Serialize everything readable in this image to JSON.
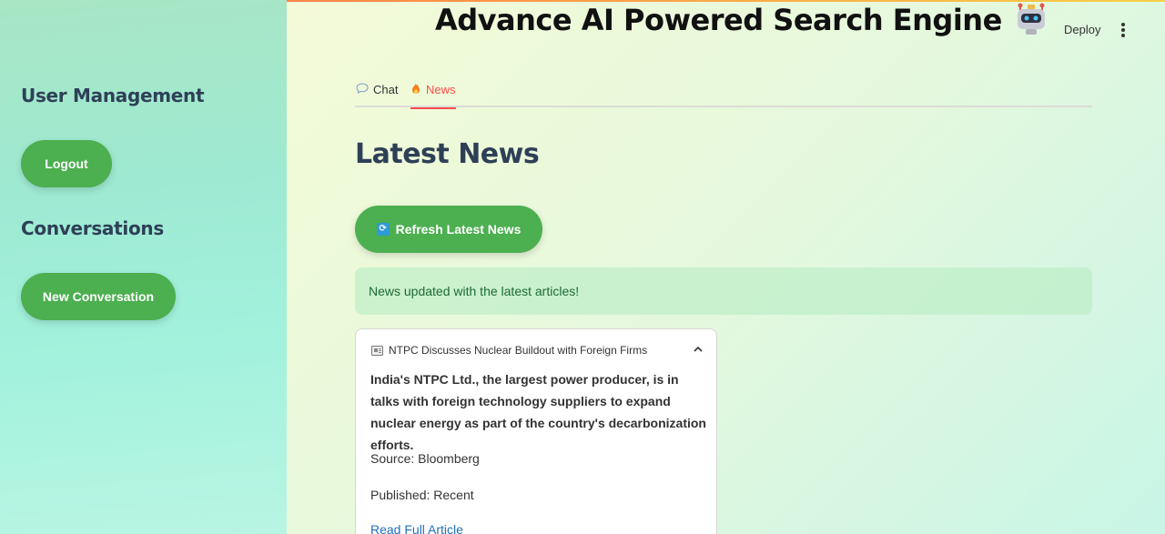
{
  "header": {
    "title": "Advance AI Powered Search Engine",
    "robot_icon": "robot-emoji",
    "deploy_label": "Deploy",
    "menu_icon": "kebab-menu-icon"
  },
  "sidebar": {
    "user_management_heading": "User Management",
    "logout_label": "Logout",
    "conversations_heading": "Conversations",
    "new_conversation_label": "New Conversation"
  },
  "tabs": [
    {
      "label": "Chat",
      "icon": "speech-bubble-icon",
      "active": false
    },
    {
      "label": "News",
      "icon": "fire-icon",
      "active": true
    }
  ],
  "main": {
    "page_title": "Latest News",
    "refresh_label": "Refresh Latest News",
    "alert_text": "News updated with the latest articles!",
    "article": {
      "title": "NTPC Discusses Nuclear Buildout with Foreign Firms",
      "summary": "India's NTPC Ltd., the largest power producer, is in talks with foreign technology suppliers to expand nuclear energy as part of the country's decarbonization efforts.",
      "source": "Source: Bloomberg",
      "published": "Published: Recent",
      "link_text": "Read Full Article"
    }
  },
  "colors": {
    "accent_green": "#4caf50",
    "active_tab": "#ff4b4b",
    "heading": "#2e4057",
    "link": "#1f6fbf"
  }
}
